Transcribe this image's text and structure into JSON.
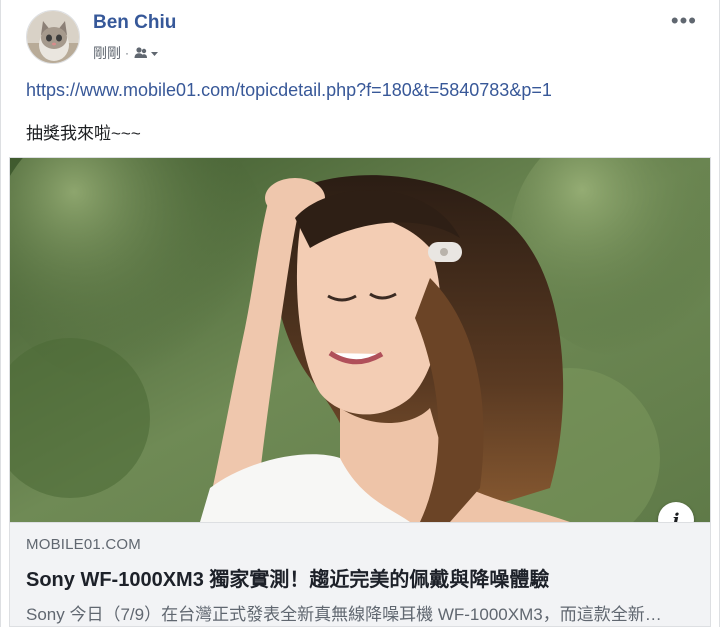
{
  "post": {
    "author": "Ben Chiu",
    "timestamp": "剛剛",
    "separator": "·",
    "audience_icon": "friends-icon",
    "more_label": "•••",
    "link": "https://www.mobile01.com/topicdetail.php?f=180&t=5840783&p=1",
    "text": "抽獎我來啦~~~"
  },
  "attachment": {
    "image_icon": "photo",
    "info_label": "i",
    "domain": "MOBILE01.COM",
    "title": "Sony WF-1000XM3 獨家實測！趨近完美的佩戴與降噪體驗",
    "description": "Sony 今日（7/9）在台灣正式發表全新真無線降噪耳機 WF-1000XM3，而這款全新…"
  },
  "colors": {
    "link": "#385898",
    "author": "#365899",
    "caption_bg": "#f2f3f5",
    "muted": "#606770"
  }
}
